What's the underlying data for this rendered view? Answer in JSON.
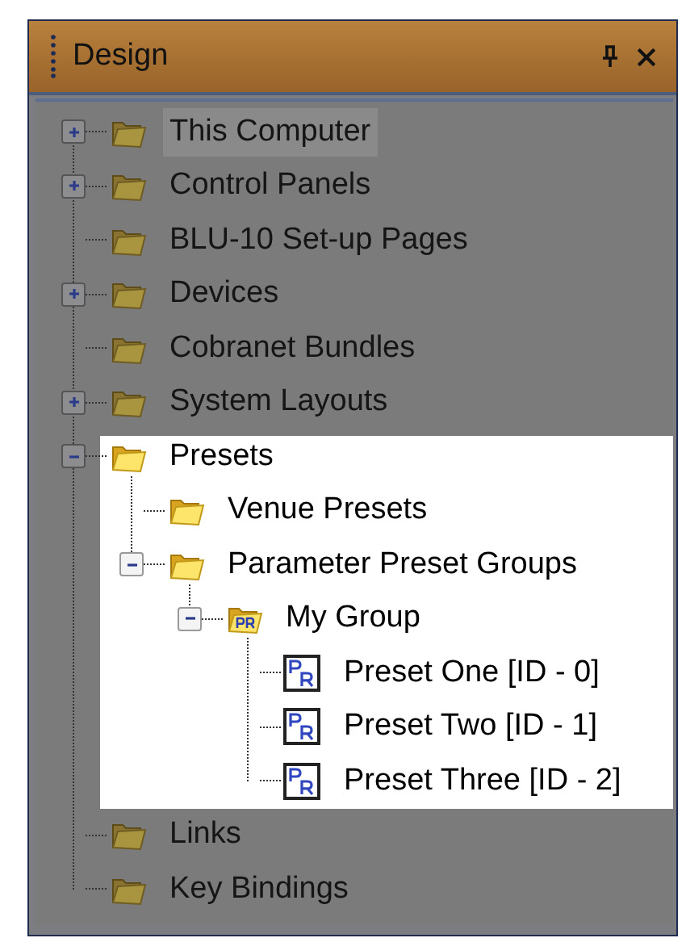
{
  "panel": {
    "title": "Design"
  },
  "tree": [
    {
      "label": "This Computer",
      "kind": "folder",
      "expanded": false,
      "selected": true,
      "highlighted": false
    },
    {
      "label": "Control Panels",
      "kind": "folder",
      "expanded": false,
      "selected": false,
      "highlighted": false
    },
    {
      "label": "BLU-10 Set-up Pages",
      "kind": "folder",
      "selected": false,
      "highlighted": false
    },
    {
      "label": "Devices",
      "kind": "folder",
      "expanded": false,
      "selected": false,
      "highlighted": false
    },
    {
      "label": "Cobranet Bundles",
      "kind": "folder",
      "selected": false,
      "highlighted": false
    },
    {
      "label": "System Layouts",
      "kind": "folder",
      "expanded": false,
      "selected": false,
      "highlighted": false
    },
    {
      "label": "Presets",
      "kind": "folder",
      "expanded": true,
      "selected": false,
      "highlighted": true,
      "children": [
        {
          "label": "Venue Presets",
          "kind": "folder",
          "selected": false
        },
        {
          "label": "Parameter Preset Groups",
          "kind": "folder",
          "expanded": true,
          "selected": false,
          "children": [
            {
              "label": "My Group",
              "kind": "group",
              "expanded": true,
              "selected": false,
              "children": [
                {
                  "label": "Preset One [ID - 0]",
                  "kind": "preset",
                  "selected": false
                },
                {
                  "label": "Preset Two [ID - 1]",
                  "kind": "preset",
                  "selected": false
                },
                {
                  "label": "Preset Three [ID - 2]",
                  "kind": "preset",
                  "selected": false
                }
              ]
            }
          ]
        }
      ]
    },
    {
      "label": "Links",
      "kind": "folder",
      "selected": false,
      "highlighted": false
    },
    {
      "label": "Key Bindings",
      "kind": "folder",
      "selected": false,
      "highlighted": false
    }
  ]
}
